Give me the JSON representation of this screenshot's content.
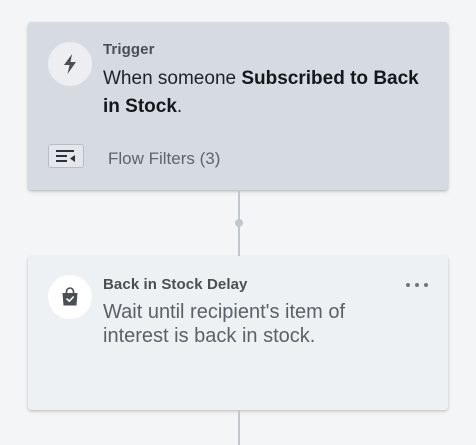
{
  "trigger": {
    "label": "Trigger",
    "desc_prefix": "When someone ",
    "desc_emphasis": "Subscribed to Back in Stock",
    "desc_suffix": ".",
    "icon": "lightning-bolt-icon",
    "filters_label": "Flow Filters (3)"
  },
  "delay": {
    "label": "Back in Stock Delay",
    "desc": "Wait until recipient's item of interest is back in stock.",
    "icon": "shopping-bag-icon"
  },
  "colors": {
    "trigger_card_bg": "#d6dbe2",
    "delay_card_bg": "#edf1f3",
    "connector": "#c2c7cd"
  }
}
